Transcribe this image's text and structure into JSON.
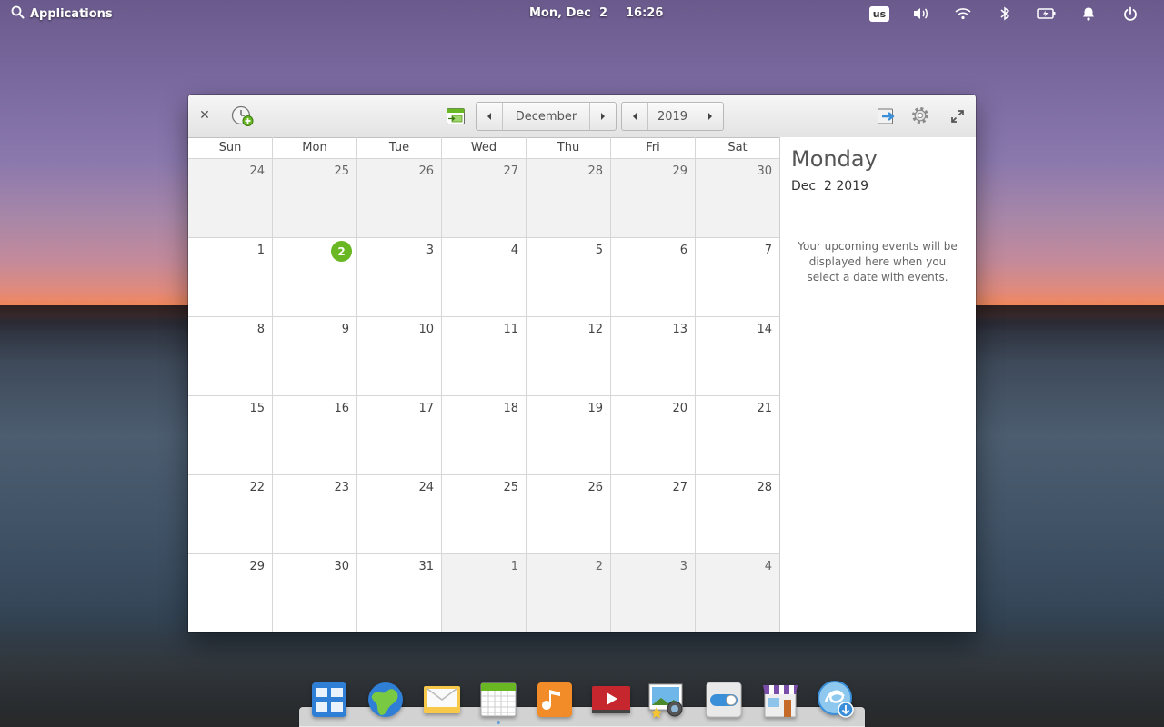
{
  "panel": {
    "applications_label": "Applications",
    "date": "Mon, Dec  2",
    "time": "16:26",
    "keyboard_layout": "us",
    "indicators": [
      "volume-icon",
      "wifi-icon",
      "bluetooth-icon",
      "battery-icon",
      "notifications-icon",
      "power-icon"
    ]
  },
  "window": {
    "month_label": "December",
    "year_label": "2019",
    "weekdays": [
      "Sun",
      "Mon",
      "Tue",
      "Wed",
      "Thu",
      "Fri",
      "Sat"
    ],
    "days": [
      {
        "n": "24",
        "other": true
      },
      {
        "n": "25",
        "other": true
      },
      {
        "n": "26",
        "other": true
      },
      {
        "n": "27",
        "other": true
      },
      {
        "n": "28",
        "other": true
      },
      {
        "n": "29",
        "other": true
      },
      {
        "n": "30",
        "other": true
      },
      {
        "n": "1"
      },
      {
        "n": "2",
        "today": true
      },
      {
        "n": "3"
      },
      {
        "n": "4"
      },
      {
        "n": "5"
      },
      {
        "n": "6"
      },
      {
        "n": "7"
      },
      {
        "n": "8"
      },
      {
        "n": "9"
      },
      {
        "n": "10"
      },
      {
        "n": "11"
      },
      {
        "n": "12"
      },
      {
        "n": "13"
      },
      {
        "n": "14"
      },
      {
        "n": "15"
      },
      {
        "n": "16"
      },
      {
        "n": "17"
      },
      {
        "n": "18"
      },
      {
        "n": "19"
      },
      {
        "n": "20"
      },
      {
        "n": "21"
      },
      {
        "n": "22"
      },
      {
        "n": "23"
      },
      {
        "n": "24"
      },
      {
        "n": "25"
      },
      {
        "n": "26"
      },
      {
        "n": "27"
      },
      {
        "n": "28"
      },
      {
        "n": "29"
      },
      {
        "n": "30"
      },
      {
        "n": "31"
      },
      {
        "n": "1",
        "other": true
      },
      {
        "n": "2",
        "other": true
      },
      {
        "n": "3",
        "other": true
      },
      {
        "n": "4",
        "other": true
      }
    ],
    "today_color": "#68b723"
  },
  "agenda": {
    "weekday": "Monday",
    "date": "Dec  2 2019",
    "empty_message": "Your upcoming events will be displayed here when you select a date with events."
  },
  "dock": {
    "apps": [
      "multitasking-view-icon",
      "web-browser-icon",
      "mail-icon",
      "calendar-icon",
      "music-icon",
      "videos-icon",
      "photos-icon",
      "settings-icon",
      "appcenter-icon",
      "installer-icon"
    ],
    "active": "calendar-icon"
  }
}
